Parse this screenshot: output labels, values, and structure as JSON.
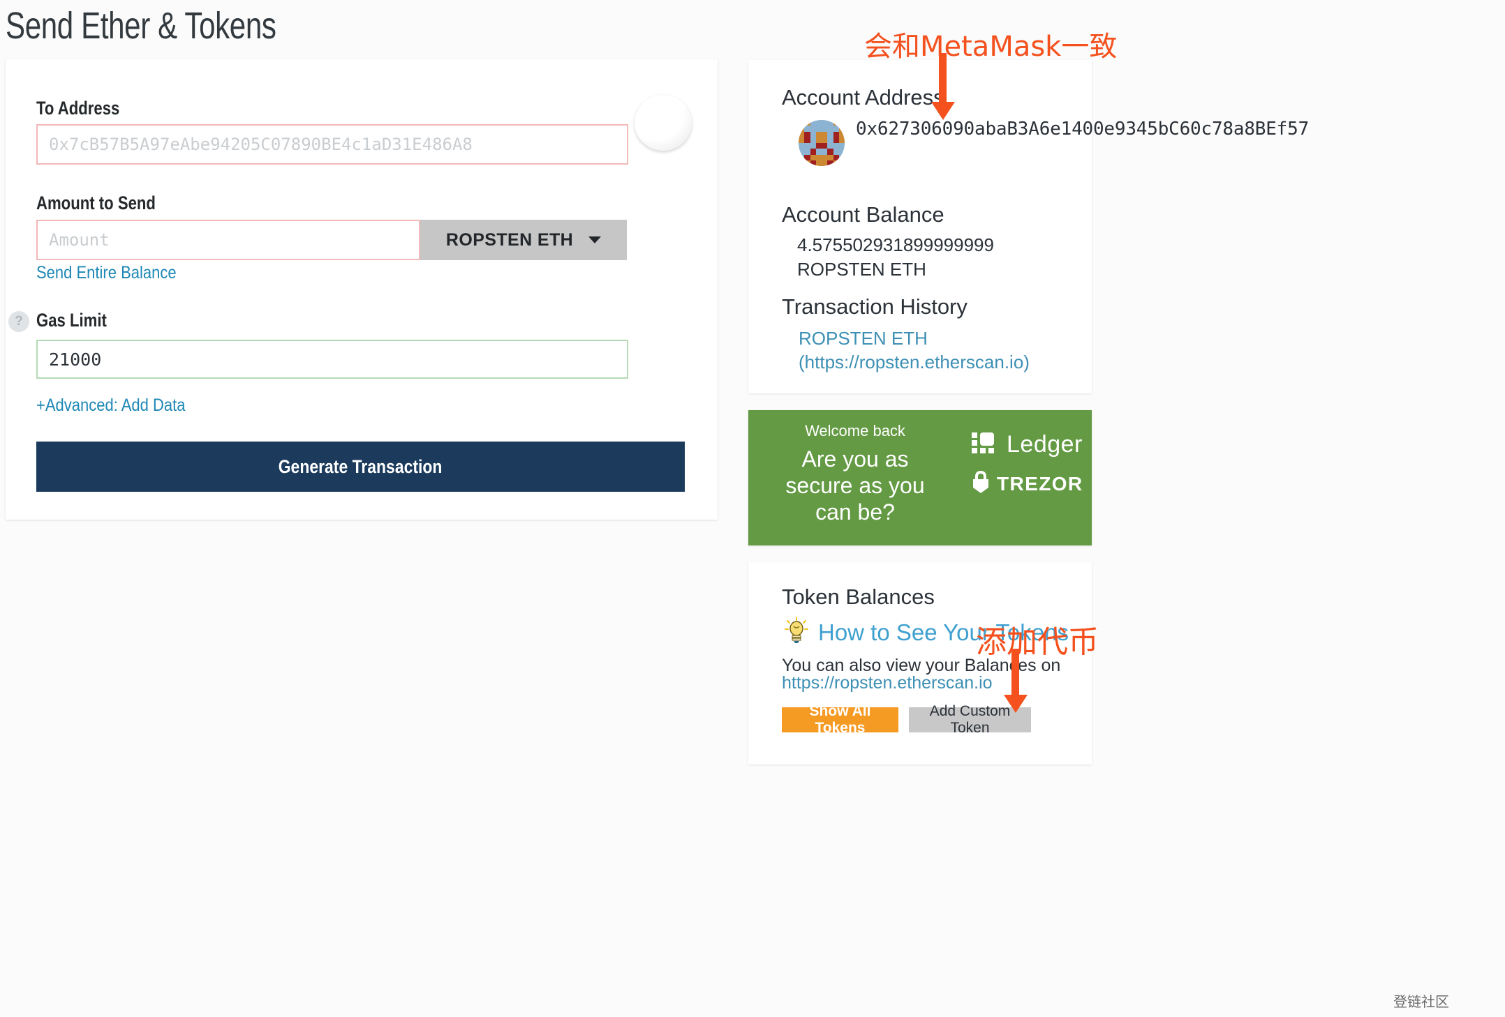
{
  "page": {
    "title": "Send Ether & Tokens",
    "watermark": "登链社区"
  },
  "form": {
    "to_address_label": "To Address",
    "to_address_placeholder": "0x7cB57B5A97eAbe94205C07890BE4c1aD31E486A8",
    "to_address_value": "",
    "amount_label": "Amount to Send",
    "amount_placeholder": "Amount",
    "amount_value": "",
    "unit_selected": "ROPSTEN ETH",
    "unit_caret_icon": "chevron-down-icon",
    "send_entire_balance_label": "Send Entire Balance",
    "gas_limit_label": "Gas Limit",
    "gas_limit_value": "21000",
    "gas_help_icon": "question-mark-icon",
    "advanced_add_data_label": "+Advanced: Add Data",
    "generate_button_label": "Generate Transaction"
  },
  "sidebar": {
    "account_address_label": "Account Address",
    "account_address_value": "0x627306090abaB3A6e1400e9345bC60c78a8BEf57",
    "account_balance_label": "Account Balance",
    "account_balance_value": "4.575502931899999999 ROPSTEN ETH",
    "transaction_history_label": "Transaction History",
    "transaction_history_link": "ROPSTEN ETH (https://ropsten.etherscan.io)",
    "promo": {
      "welcome": "Welcome back",
      "headline": "Are you as secure as you can be?",
      "brand_ledger": "Ledger",
      "brand_trezor": "TREZOR"
    },
    "tokens": {
      "title": "Token Balances",
      "how_to_link": "How to See Your Tokens",
      "note": "You can also view your Balances on",
      "etherscan_link": "https://ropsten.etherscan.io",
      "show_all_label": "Show All Tokens",
      "add_custom_label": "Add Custom Token",
      "bulb_icon": "lightbulb-icon"
    }
  },
  "annotations": {
    "top": "会和MetaMask一致",
    "bottom": "添加代币"
  },
  "colors": {
    "accent_link": "#1d87b5",
    "primary_button": "#1b3a5c",
    "promo_green": "#639a43",
    "orange_button": "#f59a23",
    "annotation_orange": "#f4511e",
    "error_border": "#f5b8b8",
    "valid_border": "#b4dcb4"
  }
}
